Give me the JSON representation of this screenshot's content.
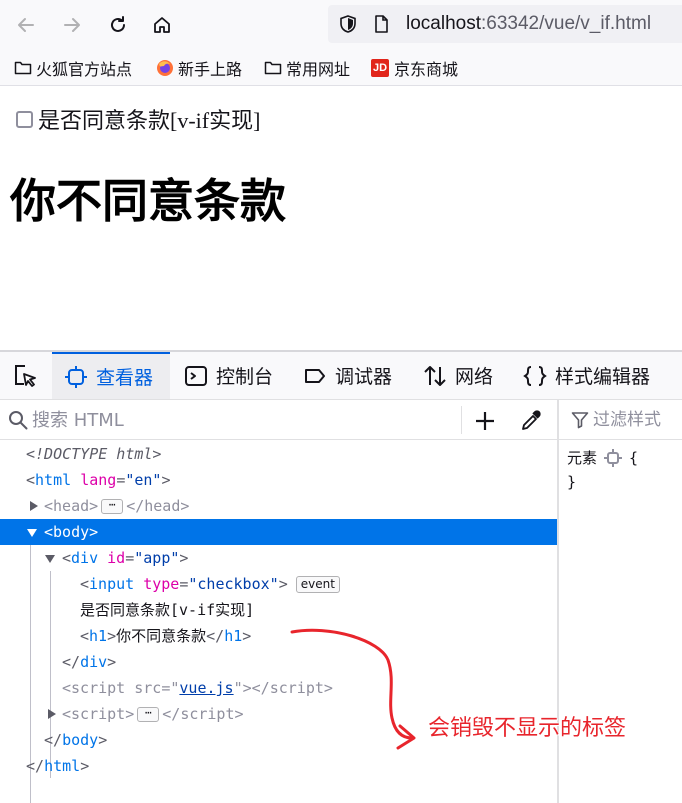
{
  "browser": {
    "url_host": "localhost",
    "url_rest": ":63342/vue/v_if.html",
    "bookmarks": [
      {
        "label": "火狐官方站点",
        "icon": "folder-icon"
      },
      {
        "label": "新手上路",
        "icon": "firefox-icon"
      },
      {
        "label": "常用网址",
        "icon": "folder-icon"
      },
      {
        "label": "京东商城",
        "icon": "jd-icon",
        "logo_text": "JD"
      }
    ]
  },
  "page": {
    "checkbox_label": "是否同意条款[v-if实现]",
    "checkbox_checked": false,
    "heading": "你不同意条款"
  },
  "devtools": {
    "tabs": [
      {
        "label": "查看器",
        "icon": "inspector-icon",
        "active": true
      },
      {
        "label": "控制台",
        "icon": "console-icon",
        "active": false
      },
      {
        "label": "调试器",
        "icon": "debugger-icon",
        "active": false
      },
      {
        "label": "网络",
        "icon": "network-icon",
        "active": false
      },
      {
        "label": "样式编辑器",
        "icon": "style-editor-icon",
        "active": false
      }
    ],
    "search_placeholder": "搜索 HTML",
    "filter_placeholder": "过滤样式",
    "rules": {
      "selector": "元素",
      "open_brace": "{",
      "close_brace": "}"
    },
    "tree": {
      "doctype": "<!DOCTYPE html>",
      "html_open_tag": "html",
      "html_lang_attr": "lang",
      "html_lang_val": "\"en\"",
      "head_tag": "head",
      "body_tag": "body",
      "div_tag": "div",
      "div_id_attr": "id",
      "div_id_val": "\"app\"",
      "input_tag": "input",
      "input_type_attr": "type",
      "input_type_val": "\"checkbox\"",
      "event_badge": "event",
      "text_node": "是否同意条款[v-if实现]",
      "h1_tag": "h1",
      "h1_text": "你不同意条款",
      "script_tag": "script",
      "script_src_attr": "src",
      "script_src_val": "vue.js",
      "ellipsis": "⋯"
    }
  },
  "annotation": {
    "text": "会销毁不显示的标签",
    "color": "#e8252c"
  }
}
